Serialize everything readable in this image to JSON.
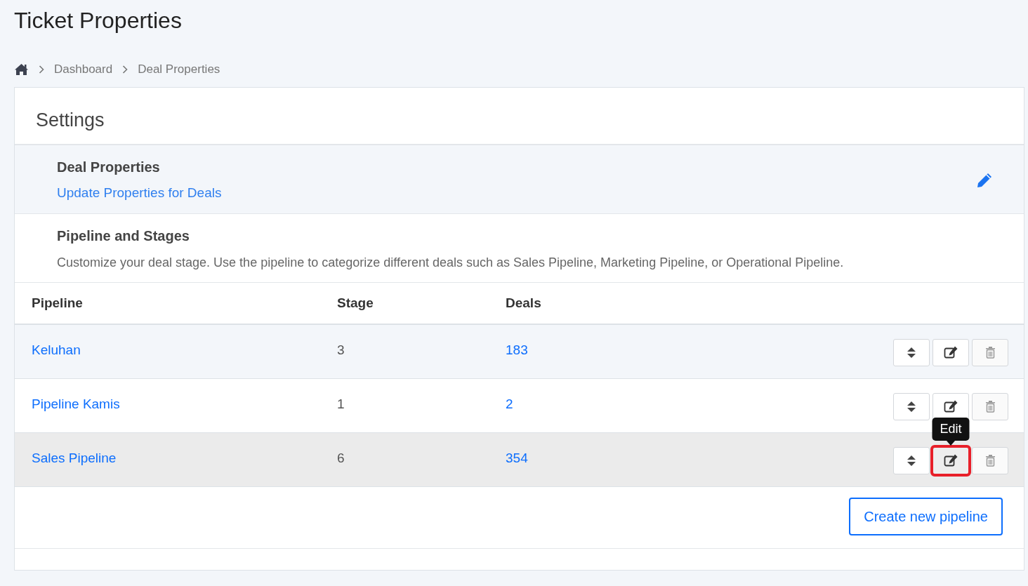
{
  "page_title": "Ticket Properties",
  "breadcrumb": [
    {
      "label": "Dashboard"
    },
    {
      "label": "Deal Properties"
    }
  ],
  "settings": {
    "title": "Settings",
    "deal_properties": {
      "title": "Deal Properties",
      "link": "Update Properties for Deals"
    },
    "pipeline_section": {
      "title": "Pipeline and Stages",
      "description": "Customize your deal stage. Use the pipeline to categorize different deals such as Sales Pipeline, Marketing Pipeline, or Operational Pipeline."
    }
  },
  "table": {
    "columns": [
      "Pipeline",
      "Stage",
      "Deals"
    ],
    "rows": [
      {
        "pipeline": "Keluhan",
        "stage": "3",
        "deals": "183",
        "hovered": false,
        "edit_highlighted": false
      },
      {
        "pipeline": "Pipeline Kamis",
        "stage": "1",
        "deals": "2",
        "hovered": false,
        "edit_highlighted": false
      },
      {
        "pipeline": "Sales Pipeline",
        "stage": "6",
        "deals": "354",
        "hovered": true,
        "edit_highlighted": true,
        "tooltip": "Edit"
      }
    ]
  },
  "create_button": "Create new pipeline"
}
